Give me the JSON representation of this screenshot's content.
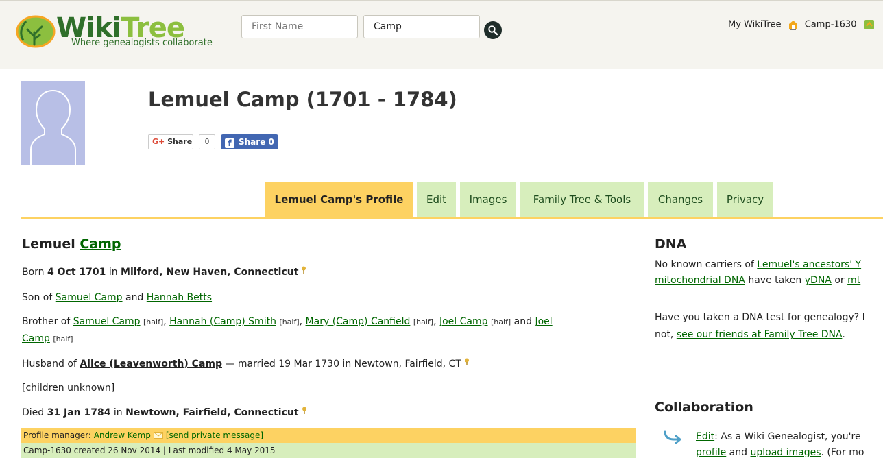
{
  "header": {
    "logo_word_1": "Wiki",
    "logo_word_2": "Tree",
    "logo_tagline": "Where genealogists collaborate",
    "first_name_placeholder": "First Name",
    "last_name_value": "Camp",
    "my_wikitree": "My WikiTree",
    "user_id": "Camp-1630"
  },
  "profile": {
    "title": "Lemuel Camp (1701 - 1784)",
    "share": {
      "google_label": "Share",
      "google_prefix": "G+",
      "google_count": "0",
      "facebook_label": "Share 0",
      "facebook_icon": "f"
    }
  },
  "tabs": [
    {
      "label": "Lemuel Camp's Profile",
      "active": true
    },
    {
      "label": "Edit"
    },
    {
      "label": "Images"
    },
    {
      "label": "Family Tree & Tools"
    },
    {
      "label": "Changes"
    },
    {
      "label": "Privacy"
    }
  ],
  "bio": {
    "first_name": "Lemuel",
    "last_name": "Camp",
    "born": {
      "prefix": "Born",
      "date": "4 Oct 1701",
      "in": "in",
      "place": "Milford, New Haven, Connecticut"
    },
    "parents": {
      "prefix": "Son of",
      "father": "Samuel Camp",
      "and": "and",
      "mother": "Hannah Betts"
    },
    "siblings": {
      "prefix": "Brother of",
      "half": "[half]",
      "and": "and",
      "list": [
        "Samuel Camp",
        "Hannah (Camp) Smith",
        "Mary (Camp) Canfield",
        "Joel Camp",
        "Joel"
      ],
      "last_wrap": "Camp"
    },
    "spouse": {
      "prefix": "Husband of",
      "name": "Alice (Leavenworth) Camp",
      "details": "— married 19 Mar 1730 in Newtown, Fairfield, CT"
    },
    "children": "[children unknown]",
    "died": {
      "prefix": "Died",
      "date": "31 Jan 1784",
      "in": "in",
      "place": "Newtown, Fairfield, Connecticut"
    }
  },
  "manager": {
    "label": "Profile manager:",
    "name": "Andrew Kemp",
    "message_link": "[send private message]",
    "created": "Camp-1630 created 26 Nov 2014 | Last modified 4 May 2015"
  },
  "dna": {
    "heading": "DNA",
    "line1_text": "No known carriers of ",
    "line1_link": "Lemuel's ancestors' Y",
    "line2_link1": "mitochondrial DNA",
    "line2_text": " have taken ",
    "line2_link2": "yDNA",
    "line2_or": " or ",
    "line2_link3": "mt",
    "q_line1": "Have you taken a DNA test for genealogy? I",
    "q_line2_text": "not, ",
    "q_line2_link": "see our friends at Family Tree DNA",
    "q_line2_end": "."
  },
  "collaboration": {
    "heading": "Collaboration",
    "edit_link": "Edit",
    "edit_text": ": As a Wiki Genealogist, you're",
    "line2_link1": "profile",
    "line2_and": " and ",
    "line2_link2": "upload images",
    "line2_text": ". (For mo"
  },
  "colors": {
    "header_bg": "#f5f4ef",
    "tab_green": "#d7eebc",
    "tab_active": "#fdd262",
    "link_green": "#006600",
    "facebook_blue": "#4267b2"
  },
  "icons": [
    "wikitree-tree-logo",
    "search-icon",
    "house-icon",
    "green-square-icon",
    "avatar-silhouette",
    "pin-icon",
    "mail-icon",
    "arrow-icon"
  ]
}
